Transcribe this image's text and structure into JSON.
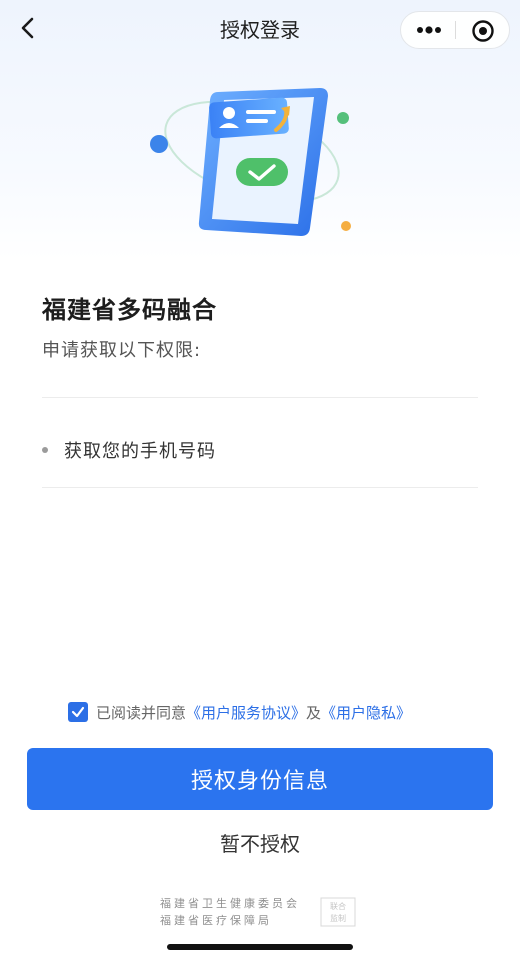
{
  "nav": {
    "title": "授权登录",
    "back_icon": "chevron-left-icon",
    "more_icon": "more-dots-icon",
    "close_icon": "target-circle-icon"
  },
  "illustration": {
    "name": "phone-authorization-illustration"
  },
  "content": {
    "app_name": "福建省多码融合",
    "request_text": "申请获取以下权限:",
    "permissions": [
      "获取您的手机号码"
    ]
  },
  "agreement": {
    "checked": true,
    "prefix": "已阅读并同意",
    "link1": "《用户服务协议》",
    "connector": "及",
    "link2": "《用户隐私》"
  },
  "buttons": {
    "authorize": "授权身份信息",
    "skip": "暂不授权"
  },
  "footer": {
    "line1": "福建省卫生健康委员会",
    "line2": "福建省医疗保障局",
    "seal_text": "联合监制"
  },
  "colors": {
    "accent": "#2b74ef",
    "link": "#2c6fe6",
    "background_top": "#eef4fd"
  }
}
